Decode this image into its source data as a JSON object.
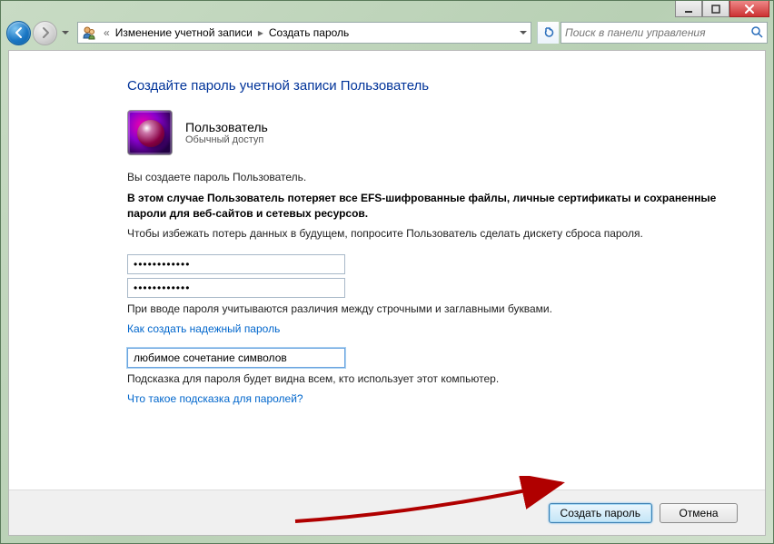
{
  "breadcrumb": {
    "item1": "Изменение учетной записи",
    "item2": "Создать пароль"
  },
  "search": {
    "placeholder": "Поиск в панели управления"
  },
  "page": {
    "title": "Создайте пароль учетной записи Пользователь",
    "username": "Пользователь",
    "role": "Обычный доступ",
    "line1": "Вы создаете пароль Пользователь.",
    "warning": "В этом случае Пользователь потеряет все EFS-шифрованные файлы, личные сертификаты и сохраненные пароли для веб-сайтов и сетевых ресурсов.",
    "line2": "Чтобы избежать потерь данных в будущем, попросите Пользователь сделать дискету сброса пароля.",
    "pw1": "••••••••••••",
    "pw2": "••••••••••••",
    "caseNote": "При вводе пароля учитываются различия между строчными и заглавными буквами.",
    "link1": "Как создать надежный пароль",
    "hintValue": "любимое сочетание символов",
    "hintNote": "Подсказка для пароля будет видна всем, кто использует этот компьютер.",
    "link2": "Что такое подсказка для паролей?"
  },
  "buttons": {
    "create": "Создать пароль",
    "cancel": "Отмена"
  }
}
